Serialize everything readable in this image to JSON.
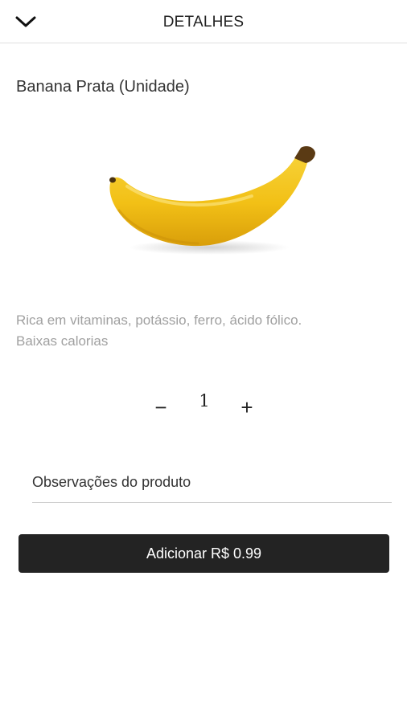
{
  "header": {
    "title": "DETALHES",
    "back_icon": "chevron-down-icon"
  },
  "product": {
    "name": "Banana Prata (Unidade)",
    "image": "banana-image",
    "description_line1": "Rica em vitaminas, potássio, ferro, ácido fólico.",
    "description_line2": "Baixas calorias"
  },
  "quantity": {
    "minus_label": "−",
    "value": "1",
    "plus_label": "+"
  },
  "notes": {
    "placeholder": "Observações do produto",
    "value": ""
  },
  "add_button": {
    "label": "Adicionar R$ 0.99"
  },
  "colors": {
    "button_bg": "#232323",
    "description_text": "#a0a0a0",
    "banana_yellow": "#f2c21a"
  }
}
